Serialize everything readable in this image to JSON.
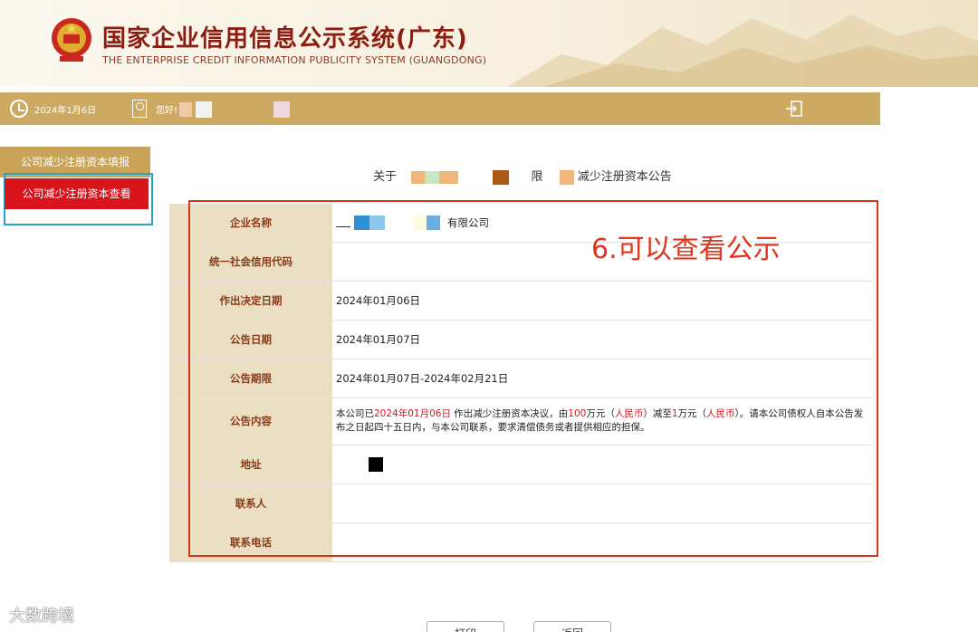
{
  "header": {
    "title": "国家企业信用信息公示系统(广东)",
    "subtitle": "THE ENTERPRISE CREDIT INFORMATION PUBLICITY SYSTEM (GUANGDONG)"
  },
  "userbar": {
    "date": "2024年1月6日",
    "greeting": "您好!"
  },
  "sidebar": {
    "items": [
      {
        "label": "公司减少注册资本填报"
      },
      {
        "label": "公司减少注册资本查看"
      }
    ]
  },
  "main": {
    "title_prefix": "关于",
    "title_mid": "限",
    "title_suffix": "减少注册资本公告",
    "annotation": "6.可以查看公示",
    "rows": [
      {
        "label": "企业名称",
        "value": "有限公司"
      },
      {
        "label": "统一社会信用代码",
        "value": ""
      },
      {
        "label": "作出决定日期",
        "value": "2024年01月06日"
      },
      {
        "label": "公告日期",
        "value": "2024年01月07日"
      },
      {
        "label": "公告期限",
        "value": "2024年01月07日-2024年02月21日"
      },
      {
        "label": "公告内容",
        "value": ""
      },
      {
        "label": "地址",
        "value": ""
      },
      {
        "label": "联系人",
        "value": ""
      },
      {
        "label": "联系电话",
        "value": ""
      }
    ],
    "content": {
      "p1": "本公司已",
      "date": "2024年01月06日",
      "p2": "作出减少注册资本决议，由",
      "amount_before": "100",
      "p3": "万元（",
      "currency_1": "人民币",
      "p4": "）减至",
      "amount_after": "1",
      "p5": "万元（",
      "currency_2": "人民币",
      "p6": "）。请本公司债权人自本公告发布之日起四十五日内，与本公司联系，要求清偿债务或者提供相应的担保。"
    }
  },
  "buttons": {
    "print": "打印",
    "back": "返回"
  },
  "watermark": "大数跨境",
  "colors": {
    "accent": "#cdaa62",
    "active": "#d9141d",
    "label_bg": "#ebdfc3",
    "annotation": "#e0341d"
  }
}
